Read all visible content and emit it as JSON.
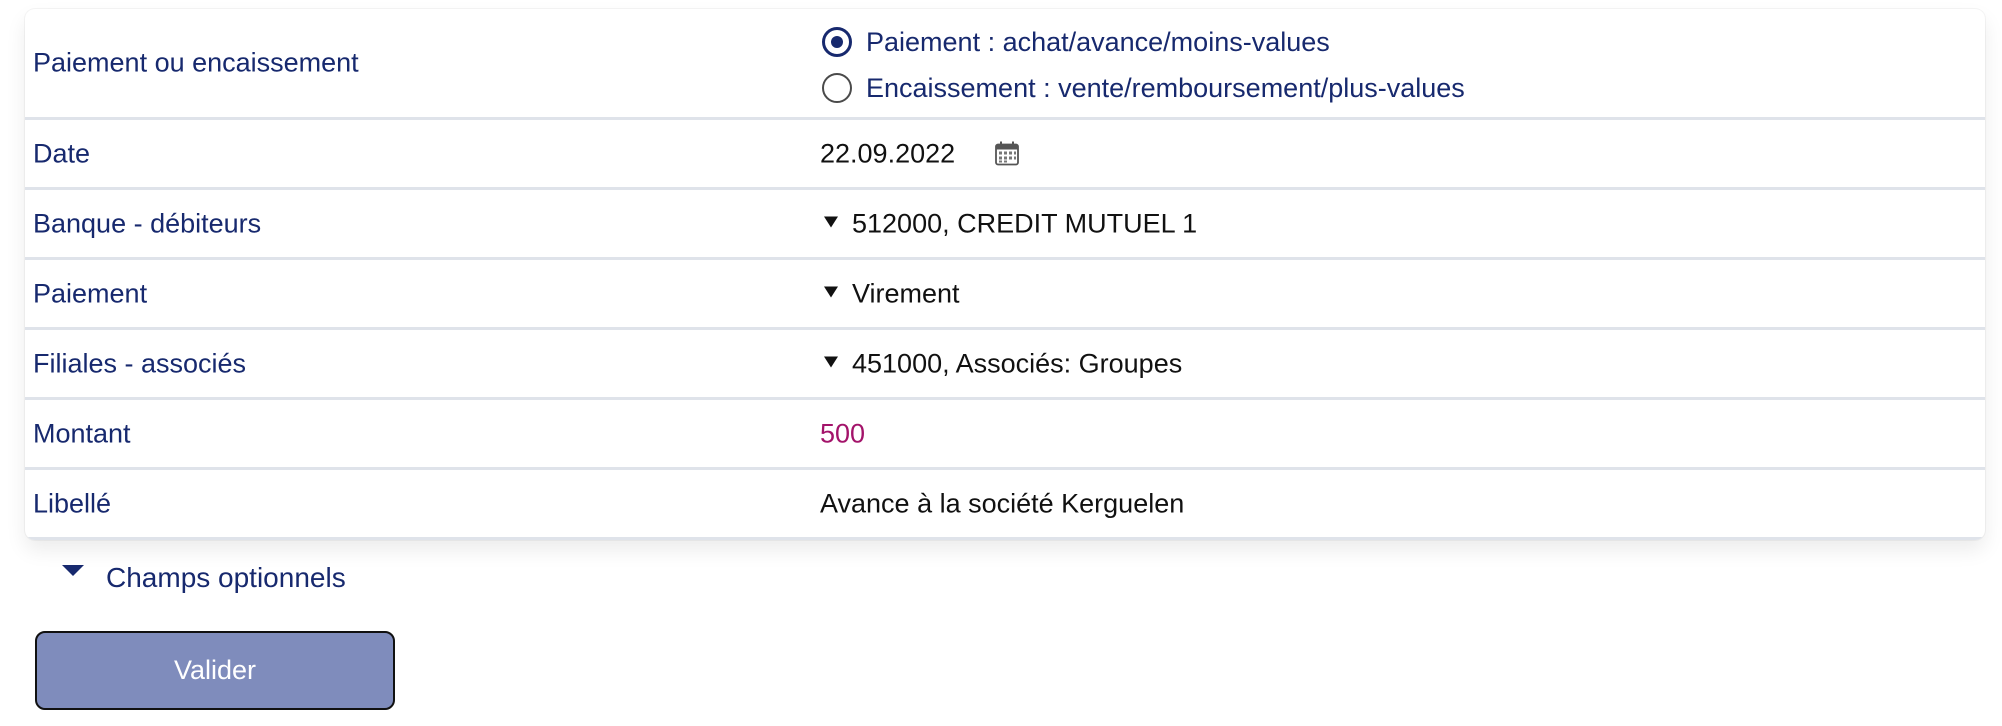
{
  "form": {
    "payment_type": {
      "label": "Paiement ou encaissement",
      "options": [
        {
          "label": "Paiement : achat/avance/moins-values",
          "checked": true
        },
        {
          "label": "Encaissement : vente/remboursement/plus-values",
          "checked": false
        }
      ]
    },
    "date": {
      "label": "Date",
      "value": "22.09.2022",
      "icon": "calendar-icon"
    },
    "bank": {
      "label": "Banque - débiteurs",
      "value": "512000, CREDIT MUTUEL 1"
    },
    "payment_method": {
      "label": "Paiement",
      "value": "Virement"
    },
    "subsidiaries": {
      "label": "Filiales - associés",
      "value": "451000, Associés: Groupes"
    },
    "amount": {
      "label": "Montant",
      "value": "500",
      "color": "#a3136a"
    },
    "description": {
      "label": "Libellé",
      "value": "Avance à la société Kerguelen"
    }
  },
  "optional_fields": {
    "label": "Champs optionnels"
  },
  "submit": {
    "label": "Valider"
  },
  "colors": {
    "label_text": "#17296e",
    "button_bg": "#7f8cbc",
    "row_divider": "#dfe3ea"
  }
}
